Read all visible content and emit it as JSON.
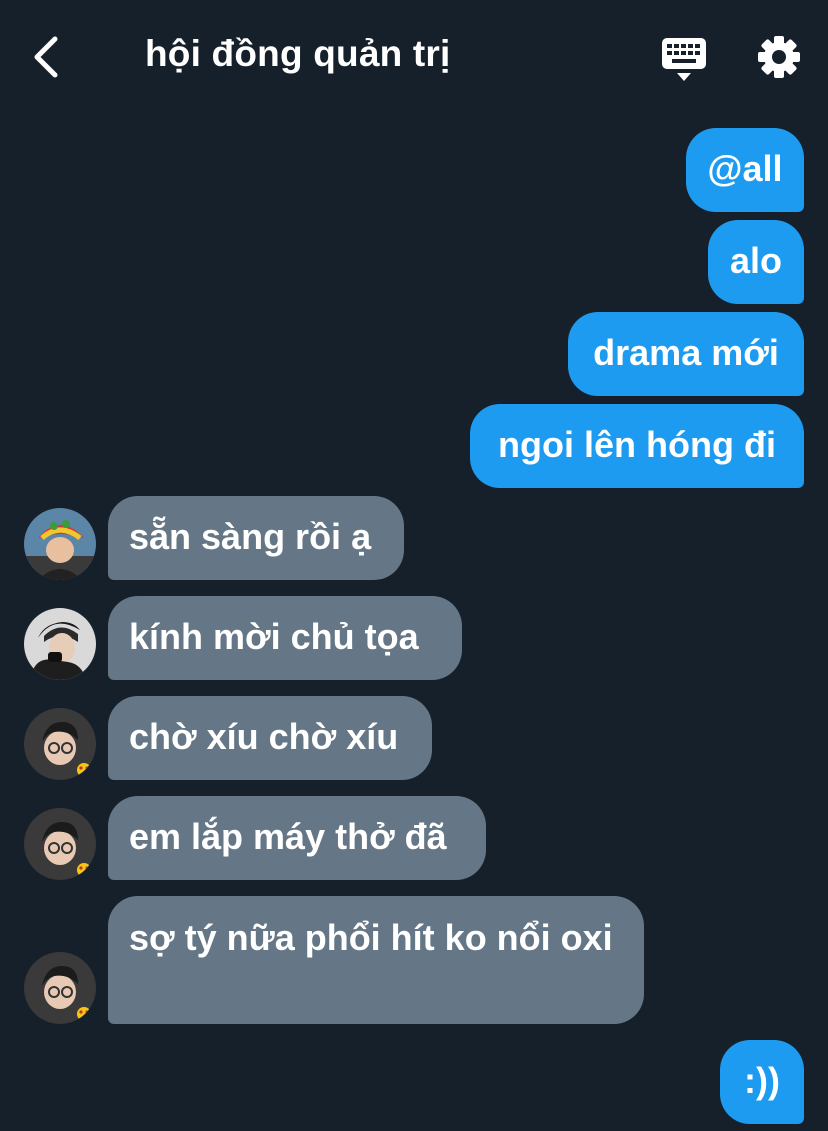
{
  "header": {
    "title": "hội đồng quản trị",
    "back_icon": "chevron-left-icon",
    "keyboard_icon": "keyboard-icon",
    "settings_icon": "gear-icon"
  },
  "colors": {
    "background": "#16202b",
    "outgoing_bubble": "#1d9bf0",
    "incoming_bubble": "#657786",
    "text": "#ffffff"
  },
  "messages": {
    "outgoing": [
      {
        "text": "@all"
      },
      {
        "text": "alo"
      },
      {
        "text": "drama mới"
      },
      {
        "text": "ngoi lên hóng đi"
      },
      {
        "text": ":))"
      }
    ],
    "incoming": [
      {
        "text": "sẵn sàng rồi ạ"
      },
      {
        "text": "kính mời chủ tọa"
      },
      {
        "text": "chờ xíu chờ xíu"
      },
      {
        "text": "em lắp máy thở đã"
      },
      {
        "text": "sợ tý nữa phổi hít ko nổi oxi"
      }
    ]
  }
}
